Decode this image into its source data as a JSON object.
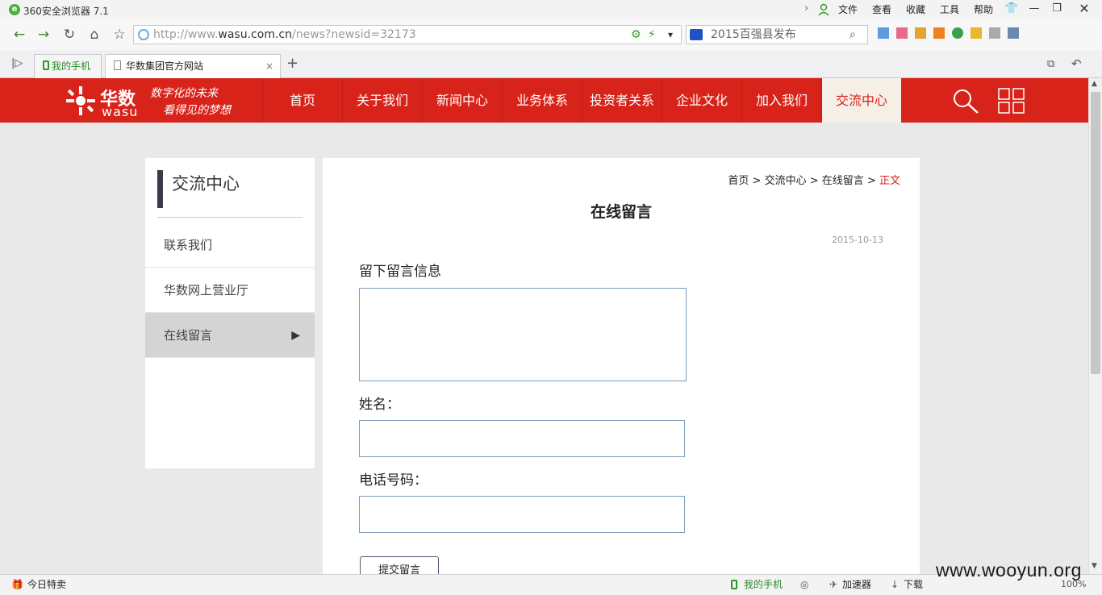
{
  "browser": {
    "title": "360安全浏览器 7.1",
    "menus": [
      "文件",
      "查看",
      "收藏",
      "工具",
      "帮助"
    ],
    "url_prefix": "http://www.",
    "url_domain": "wasu.com.cn",
    "url_path": "/news?newsid=32173",
    "search_value": "2015百强县发布",
    "tabs": [
      {
        "label": "我的手机"
      },
      {
        "label": "华数集团官方网站"
      }
    ],
    "new_tab": "+",
    "status_left": "今日特卖",
    "status_items": [
      "我的手机",
      "加速器",
      "下载"
    ],
    "zoom": "100%"
  },
  "site": {
    "brand": "华数",
    "brand_en": "wasu",
    "slogan_line1": "数字化的未来",
    "slogan_line2": "看得见的梦想",
    "nav": [
      "首页",
      "关于我们",
      "新闻中心",
      "业务体系",
      "投资者关系",
      "企业文化",
      "加入我们",
      "交流中心"
    ],
    "active_nav_index": 7,
    "sidebar": {
      "title": "交流中心",
      "items": [
        "联系我们",
        "华数网上营业厅",
        "在线留言"
      ],
      "active_index": 2
    },
    "breadcrumb": {
      "home": "首页",
      "section": "交流中心",
      "page": "在线留言",
      "current": "正文",
      "sep": ">"
    },
    "content": {
      "title": "在线留言",
      "date": "2015-10-13",
      "message_label": "留下留言信息",
      "name_label": "姓名：",
      "phone_label": "电话号码：",
      "submit_label": "提交留言"
    }
  },
  "watermark": "www.wooyun.org",
  "colors": {
    "brand_red": "#d8231a",
    "active_nav_bg": "#f5efe6"
  }
}
